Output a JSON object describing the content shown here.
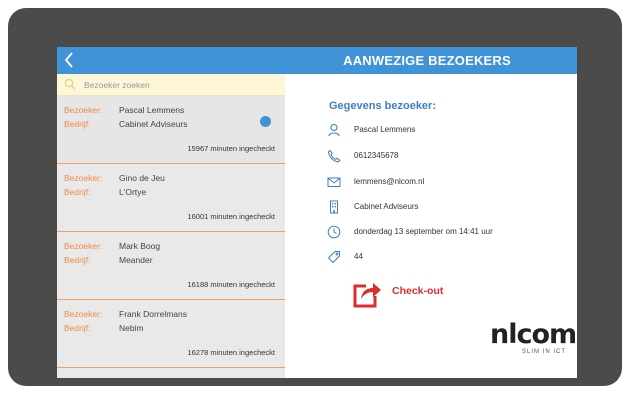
{
  "header": {
    "title": "AANWEZIGE BEZOEKERS"
  },
  "search": {
    "placeholder": "Bezoeker zoeken"
  },
  "labels": {
    "visitor": "Bezoeker:",
    "company": "Bedrijf:"
  },
  "visitors": [
    {
      "name": "Pascal Lemmens",
      "company": "Cabinet Adviseurs",
      "checked_in": "15967 minuten ingecheckt",
      "selected": true
    },
    {
      "name": "Gino de Jeu",
      "company": "L'Ortye",
      "checked_in": "16001 minuten ingecheckt"
    },
    {
      "name": "Mark Boog",
      "company": "Meander",
      "checked_in": "16188 minuten ingecheckt"
    },
    {
      "name": "Frank Dorrelmans",
      "company": "Nebim",
      "checked_in": "16278 minuten ingecheckt"
    }
  ],
  "details": {
    "title": "Gegevens bezoeker:",
    "name": "Pascal Lemmens",
    "phone": "0612345678",
    "email": "lemmens@nlcom.nl",
    "company": "Cabinet Adviseurs",
    "checkin": "donderdag 13 september om 14:41 uur",
    "tag": "44"
  },
  "checkout": {
    "label": "Check-out"
  },
  "logo": {
    "text": "nlcom",
    "tagline": "SLIM IN ICT"
  },
  "icons": {
    "back": "back-chevron-icon",
    "search": "search-icon",
    "person": "person-icon",
    "phone": "phone-icon",
    "email": "email-icon",
    "company": "building-icon",
    "time": "clock-icon",
    "tag": "tag-icon",
    "checkout": "checkout-arrow-icon"
  },
  "colors": {
    "accent": "#3f93d6",
    "label": "#f08a45",
    "title": "#3f7fc4",
    "checkout": "#e02b2b",
    "frame": "#4b4b4b"
  }
}
